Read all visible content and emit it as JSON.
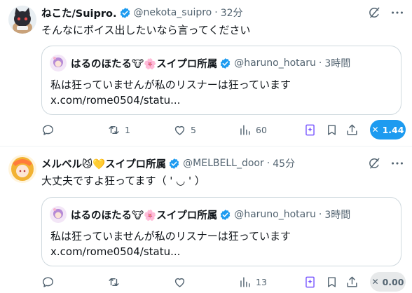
{
  "posts": [
    {
      "author_name": "ねこた/Suipro.",
      "handle": "@nekota_suipro",
      "separator": "·",
      "time": "32分",
      "text": "そんなにボイス出したいなら言ってください",
      "quote": {
        "author_name": "はるのほたる🐮🌸スイプロ所属",
        "handle": "@haruno_hotaru",
        "separator": "·",
        "time": "3時間",
        "text": "私は狂っていませんが私のリスナーは狂っています",
        "link": "x.com/rome0504/statu..."
      },
      "actions": {
        "reply_count": "",
        "repost_count": "1",
        "like_count": "5",
        "view_count": "60"
      },
      "translate_label": "1.44",
      "translate_active": true
    },
    {
      "author_name": "メルベル😼💛スイプロ所属",
      "handle": "@MELBELL_door",
      "separator": "·",
      "time": "45分",
      "text": "大丈夫ですよ狂ってます（ ' ◡ ' ）",
      "quote": {
        "author_name": "はるのほたる🐮🌸スイプロ所属",
        "handle": "@haruno_hotaru",
        "separator": "·",
        "time": "3時間",
        "text": "私は狂っていませんが私のリスナーは狂っています",
        "link": "x.com/rome0504/statu..."
      },
      "actions": {
        "reply_count": "",
        "repost_count": "",
        "like_count": "",
        "view_count": "13"
      },
      "translate_label": "0.00",
      "translate_active": false
    }
  ],
  "icons": {
    "verified": "verified-badge-icon",
    "grok": "grok-icon",
    "more": "more-icon",
    "reply": "reply-icon",
    "repost": "repost-icon",
    "like": "like-icon",
    "views": "views-icon",
    "save": "bookmark-icon",
    "share": "share-icon",
    "translate": "x-icon"
  },
  "colors": {
    "accent": "#1d9bf0",
    "text": "#0f1419",
    "secondary": "#536471",
    "border": "#cfd9de"
  }
}
